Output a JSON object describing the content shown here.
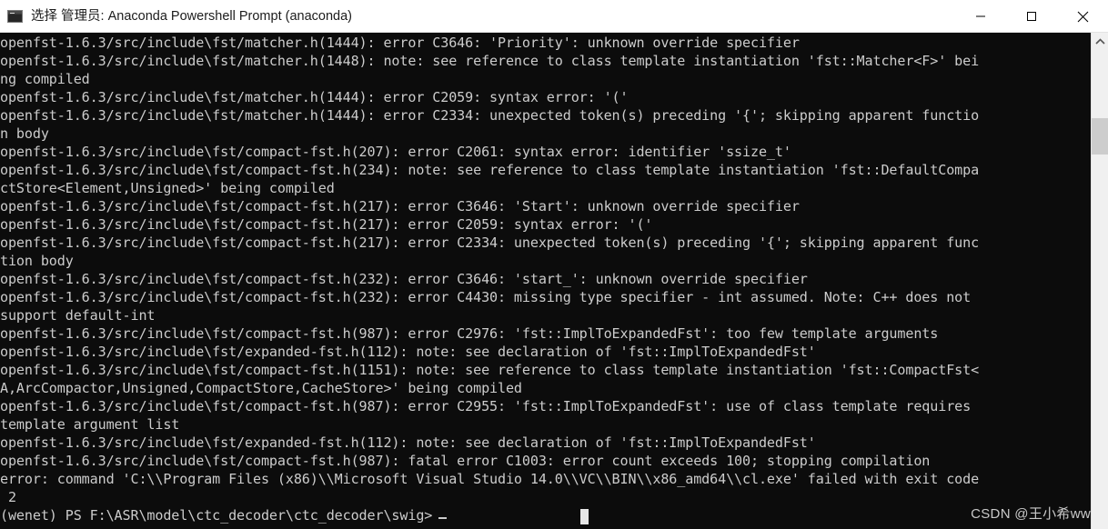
{
  "window": {
    "title": "选择 管理员: Anaconda Powershell Prompt (anaconda)",
    "icon": "console-icon",
    "titlebar_bg": "#ffffff",
    "console_bg": "#0c0c0c",
    "text_color": "#cccccc",
    "controls": {
      "minimize_label": "minimize",
      "maximize_label": "maximize",
      "close_label": "close"
    }
  },
  "scrollbar": {
    "up_arrow": "scroll-up-arrow",
    "thumb_position": "near-top"
  },
  "console": {
    "lines": [
      "openfst-1.6.3/src/include\\fst/matcher.h(1444): error C3646: 'Priority': unknown override specifier",
      "openfst-1.6.3/src/include\\fst/matcher.h(1448): note: see reference to class template instantiation 'fst::Matcher<F>' bei",
      "ng compiled",
      "openfst-1.6.3/src/include\\fst/matcher.h(1444): error C2059: syntax error: '('",
      "openfst-1.6.3/src/include\\fst/matcher.h(1444): error C2334: unexpected token(s) preceding '{'; skipping apparent functio",
      "n body",
      "openfst-1.6.3/src/include\\fst/compact-fst.h(207): error C2061: syntax error: identifier 'ssize_t'",
      "openfst-1.6.3/src/include\\fst/compact-fst.h(234): note: see reference to class template instantiation 'fst::DefaultCompa",
      "ctStore<Element,Unsigned>' being compiled",
      "openfst-1.6.3/src/include\\fst/compact-fst.h(217): error C3646: 'Start': unknown override specifier",
      "openfst-1.6.3/src/include\\fst/compact-fst.h(217): error C2059: syntax error: '('",
      "openfst-1.6.3/src/include\\fst/compact-fst.h(217): error C2334: unexpected token(s) preceding '{'; skipping apparent func",
      "tion body",
      "openfst-1.6.3/src/include\\fst/compact-fst.h(232): error C3646: 'start_': unknown override specifier",
      "openfst-1.6.3/src/include\\fst/compact-fst.h(232): error C4430: missing type specifier - int assumed. Note: C++ does not",
      "support default-int",
      "openfst-1.6.3/src/include\\fst/compact-fst.h(987): error C2976: 'fst::ImplToExpandedFst': too few template arguments",
      "openfst-1.6.3/src/include\\fst/expanded-fst.h(112): note: see declaration of 'fst::ImplToExpandedFst'",
      "openfst-1.6.3/src/include\\fst/compact-fst.h(1151): note: see reference to class template instantiation 'fst::CompactFst<",
      "A,ArcCompactor,Unsigned,CompactStore,CacheStore>' being compiled",
      "openfst-1.6.3/src/include\\fst/compact-fst.h(987): error C2955: 'fst::ImplToExpandedFst': use of class template requires",
      "template argument list",
      "openfst-1.6.3/src/include\\fst/expanded-fst.h(112): note: see declaration of 'fst::ImplToExpandedFst'",
      "openfst-1.6.3/src/include\\fst/compact-fst.h(987): fatal error C1003: error count exceeds 100; stopping compilation",
      "error: command 'C:\\\\Program Files (x86)\\\\Microsoft Visual Studio 14.0\\\\VC\\\\BIN\\\\x86_amd64\\\\cl.exe' failed with exit code",
      " 2"
    ],
    "prompt": "(wenet) PS F:\\ASR\\model\\ctc_decoder\\ctc_decoder\\swig>",
    "cursor": "block-cursor"
  },
  "watermark": {
    "text": "CSDN @王小希ww"
  }
}
